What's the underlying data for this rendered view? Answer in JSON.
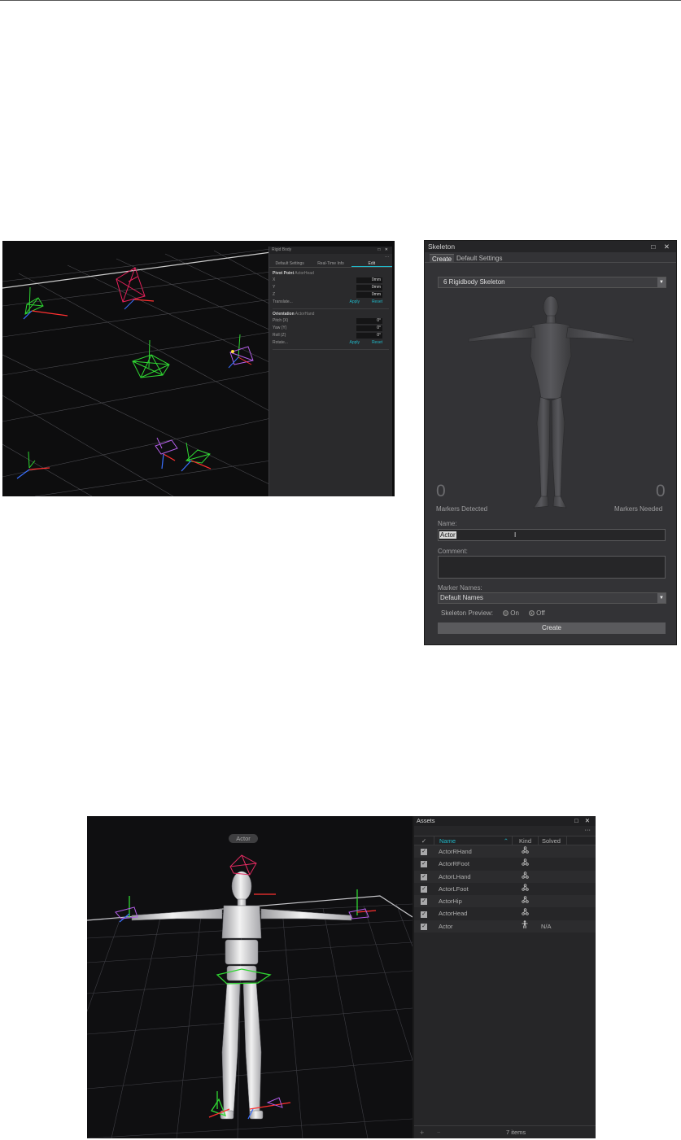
{
  "rigid_body_panel": {
    "title": "Rigid Body",
    "window_buttons": "□ ✕",
    "more": "···",
    "tabs": [
      "Default Settings",
      "Real-Time Info",
      "Edit"
    ],
    "pivot": {
      "header": "Pivot Point",
      "target": "ActorHead",
      "fields": [
        {
          "label": "X",
          "value": "0mm"
        },
        {
          "label": "Y",
          "value": "0mm"
        },
        {
          "label": "Z",
          "value": "0mm"
        }
      ],
      "action_label": "Translate...",
      "apply": "Apply",
      "reset": "Reset"
    },
    "orientation": {
      "header": "Orientation",
      "target": "ActorHand",
      "fields": [
        {
          "label": "Pitch (X)",
          "value": "0°"
        },
        {
          "label": "Yaw (Y)",
          "value": "0°"
        },
        {
          "label": "Roll (Z)",
          "value": "0°"
        }
      ],
      "action_label": "Rotate...",
      "apply": "Apply",
      "reset": "Reset"
    }
  },
  "skeleton_panel": {
    "title": "Skeleton",
    "window_buttons": "□ ✕",
    "tabs": [
      "Create",
      "Default Settings"
    ],
    "skeleton_type": "6 Rigidbody Skeleton",
    "markers_detected_count": "0",
    "markers_detected_label": "Markers Detected",
    "markers_needed_count": "0",
    "markers_needed_label": "Markers Needed",
    "name_label": "Name:",
    "name_value": "Actor",
    "comment_label": "Comment:",
    "comment_value": "",
    "marker_names_label": "Marker Names:",
    "marker_names_value": "Default Names",
    "preview_label": "Skeleton Preview:",
    "preview_on": "On",
    "preview_off": "Off",
    "preview_selected": "Off",
    "create_button": "Create"
  },
  "actor_viewport": {
    "actor_label": "Actor"
  },
  "assets_panel": {
    "title": "Assets",
    "window_buttons": "□ ✕",
    "more": "···",
    "columns": {
      "check": "✓",
      "name": "Name",
      "kind": "Kind",
      "solved": "Solved"
    },
    "rows": [
      {
        "checked": "✓",
        "name": "ActorRHand",
        "kind": "rigid-body-icon",
        "solved": ""
      },
      {
        "checked": "✓",
        "name": "ActorRFoot",
        "kind": "rigid-body-icon",
        "solved": ""
      },
      {
        "checked": "✓",
        "name": "ActorLHand",
        "kind": "rigid-body-icon",
        "solved": ""
      },
      {
        "checked": "✓",
        "name": "ActorLFoot",
        "kind": "rigid-body-icon",
        "solved": ""
      },
      {
        "checked": "✓",
        "name": "ActorHip",
        "kind": "rigid-body-icon",
        "solved": ""
      },
      {
        "checked": "✓",
        "name": "ActorHead",
        "kind": "rigid-body-icon",
        "solved": ""
      },
      {
        "checked": "✓",
        "name": "Actor",
        "kind": "skeleton-icon",
        "solved": "N/A"
      }
    ],
    "add": "+",
    "remove": "−",
    "item_count": "7 items"
  },
  "colors": {
    "accent": "#20b8c8",
    "panel_bg": "#2a2a2c",
    "viewport_bg": "#0d0d0e"
  }
}
